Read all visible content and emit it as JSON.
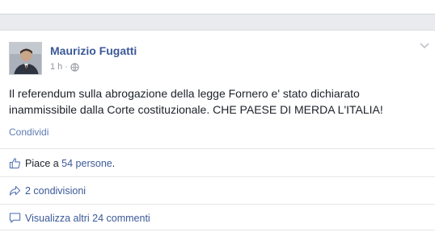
{
  "post": {
    "author": "Maurizio Fugatti",
    "time": "1 h",
    "separator": "·",
    "message": "Il referendum sulla abrogazione della legge Fornero e' stato dichiarato inammissibile dalla Corte costituzionale. CHE PAESE DI MERDA L'ITALIA!",
    "share_action": "Condividi"
  },
  "likes": {
    "prefix": "Piace a ",
    "count_link": "54 persone",
    "suffix": "."
  },
  "shares": {
    "label": "2 condivisioni"
  },
  "comments": {
    "label": "Visualizza altri 24 commenti"
  },
  "icons": {
    "menu": "chevron-down-icon",
    "privacy": "globe-icon",
    "likes": "thumbs-up-icon",
    "shares": "share-arrow-icon",
    "comments": "comment-bubble-icon"
  },
  "colors": {
    "link": "#3b5998",
    "meta": "#90949c",
    "background": "#e9ebee"
  }
}
